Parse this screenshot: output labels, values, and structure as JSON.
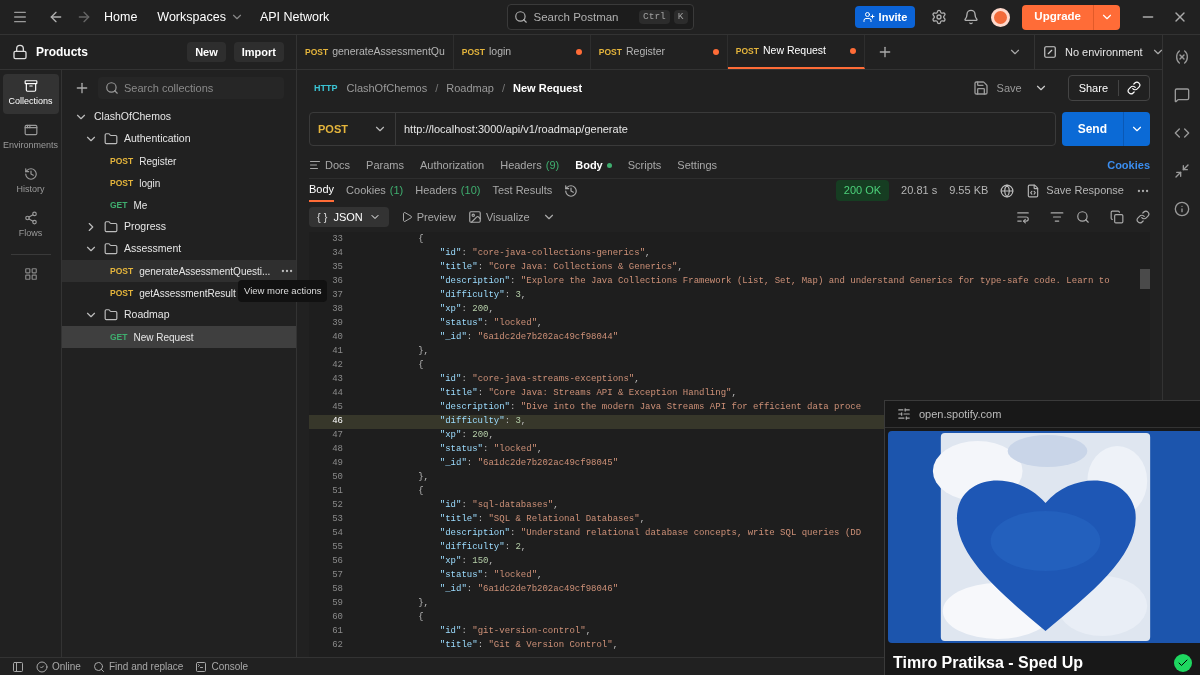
{
  "topbar": {
    "nav": [
      "Home",
      "Workspaces",
      "API Network"
    ],
    "search": {
      "placeholder": "Search Postman",
      "keys": [
        "Ctrl",
        "K"
      ]
    },
    "invite": "Invite",
    "upgrade": "Upgrade"
  },
  "sidebar": {
    "title": "Products",
    "buttons": [
      "New",
      "Import"
    ],
    "rail": [
      {
        "label": "Collections",
        "selected": true
      },
      {
        "label": "Environments",
        "selected": false
      },
      {
        "label": "History",
        "selected": false
      },
      {
        "label": "Flows",
        "selected": false
      }
    ],
    "search": {
      "placeholder": "Search collections"
    },
    "tree": [
      {
        "kind": "collection",
        "name": "ClashOfChemos",
        "expanded": true,
        "selected": false,
        "children": [
          {
            "kind": "folder",
            "name": "Authentication",
            "expanded": true,
            "selected": false,
            "children": [
              {
                "kind": "request",
                "method": {
                  "label": "POST",
                  "color": "#e5b53c"
                },
                "name": "Register",
                "selected": false,
                "hovered": false
              },
              {
                "kind": "request",
                "method": {
                  "label": "POST",
                  "color": "#e5b53c"
                },
                "name": "login",
                "selected": false,
                "hovered": false
              },
              {
                "kind": "request",
                "method": {
                  "label": "GET",
                  "color": "#3fae6f"
                },
                "name": "Me",
                "selected": false,
                "hovered": false
              }
            ]
          },
          {
            "kind": "folder",
            "name": "Progress",
            "expanded": false,
            "selected": false
          },
          {
            "kind": "folder",
            "name": "Assessment",
            "expanded": true,
            "selected": false,
            "children": [
              {
                "kind": "request",
                "method": {
                  "label": "POST",
                  "color": "#e5b53c"
                },
                "name": "generateAssessmentQuesti...",
                "selected": false,
                "hovered": true
              },
              {
                "kind": "request",
                "method": {
                  "label": "POST",
                  "color": "#e5b53c"
                },
                "name": "getAssessmentResult",
                "selected": false,
                "hovered": false
              }
            ]
          },
          {
            "kind": "folder",
            "name": "Roadmap",
            "expanded": true,
            "selected": false,
            "children": [
              {
                "kind": "request",
                "method": {
                  "label": "GET",
                  "color": "#3fae6f"
                },
                "name": "New Request",
                "selected": true,
                "hovered": false
              }
            ]
          }
        ]
      }
    ],
    "tooltip": "View more actions"
  },
  "tabs": [
    {
      "method": {
        "label": "POST",
        "color": "#e5b53c"
      },
      "name": "generateAssessmentQu",
      "unsaved": false,
      "selected": false
    },
    {
      "method": {
        "label": "POST",
        "color": "#e5b53c"
      },
      "name": "login",
      "unsaved": true,
      "selected": false
    },
    {
      "method": {
        "label": "POST",
        "color": "#e5b53c"
      },
      "name": "Register",
      "unsaved": true,
      "selected": false
    },
    {
      "method": {
        "label": "POST",
        "color": "#e5b53c"
      },
      "name": "New Request",
      "unsaved": true,
      "selected": true
    }
  ],
  "environment": "No environment",
  "breadcrumb": {
    "icon_label": "HTTP",
    "path": [
      {
        "label": "ClashOfChemos",
        "separator": "/"
      },
      {
        "label": "Roadmap",
        "separator": "/"
      }
    ],
    "current": "New Request"
  },
  "actions": {
    "save": "Save",
    "share": "Share"
  },
  "request": {
    "method": "POST",
    "url": "http://localhost:3000/api/v1/roadmap/generate",
    "send": "Send"
  },
  "request_tabs": [
    {
      "label": "Docs",
      "dot": false,
      "selected": false
    },
    {
      "label": "Params",
      "dot": false,
      "selected": false
    },
    {
      "label": "Authorization",
      "dot": false,
      "selected": false
    },
    {
      "label": "Headers",
      "count": "(9)",
      "dot": false,
      "selected": false
    },
    {
      "label": "Body",
      "dot": true,
      "selected": true
    },
    {
      "label": "Scripts",
      "dot": false,
      "selected": false
    },
    {
      "label": "Settings",
      "dot": false,
      "selected": false
    }
  ],
  "cookies_link": "Cookies",
  "response_tabs": [
    {
      "label": "Body",
      "selected": true
    },
    {
      "label": "Cookies",
      "count": "(1)",
      "selected": false
    },
    {
      "label": "Headers",
      "count": "(10)",
      "selected": false
    },
    {
      "label": "Test Results",
      "selected": false
    }
  ],
  "response_meta": {
    "status": "200 OK",
    "time": "20.81 s",
    "size": "9.55 KB",
    "save": "Save Response"
  },
  "viewer": {
    "format_icon": "{ }",
    "format": "JSON",
    "preview": "Preview",
    "visualize": "Visualize"
  },
  "code": [
    {
      "n": "33",
      "text": "        {",
      "current": false
    },
    {
      "n": "34",
      "text": "            \"id\": \"core-java-collections-generics\",",
      "current": false
    },
    {
      "n": "35",
      "text": "            \"title\": \"Core Java: Collections & Generics\",",
      "current": false
    },
    {
      "n": "36",
      "text": "            \"description\": \"Explore the Java Collections Framework (List, Set, Map) and understand Generics for type-safe code. Learn to",
      "current": false
    },
    {
      "n": "37",
      "text": "            \"difficulty\": 3,",
      "current": false
    },
    {
      "n": "38",
      "text": "            \"xp\": 200,",
      "current": false
    },
    {
      "n": "39",
      "text": "            \"status\": \"locked\",",
      "current": false
    },
    {
      "n": "40",
      "text": "            \"_id\": \"6a1dc2de7b202ac49cf98044\"",
      "current": false
    },
    {
      "n": "41",
      "text": "        },",
      "current": false
    },
    {
      "n": "42",
      "text": "        {",
      "current": false
    },
    {
      "n": "43",
      "text": "            \"id\": \"core-java-streams-exceptions\",",
      "current": false
    },
    {
      "n": "44",
      "text": "            \"title\": \"Core Java: Streams API & Exception Handling\",",
      "current": false
    },
    {
      "n": "45",
      "text": "            \"description\": \"Dive into the modern Java Streams API for efficient data proce",
      "current": false
    },
    {
      "n": "46",
      "text": "            \"difficulty\": 3,",
      "current": true
    },
    {
      "n": "47",
      "text": "            \"xp\": 200,",
      "current": false
    },
    {
      "n": "48",
      "text": "            \"status\": \"locked\",",
      "current": false
    },
    {
      "n": "49",
      "text": "            \"_id\": \"6a1dc2de7b202ac49cf98045\"",
      "current": false
    },
    {
      "n": "50",
      "text": "        },",
      "current": false
    },
    {
      "n": "51",
      "text": "        {",
      "current": false
    },
    {
      "n": "52",
      "text": "            \"id\": \"sql-databases\",",
      "current": false
    },
    {
      "n": "53",
      "text": "            \"title\": \"SQL & Relational Databases\",",
      "current": false
    },
    {
      "n": "54",
      "text": "            \"description\": \"Understand relational database concepts, write SQL queries (DD",
      "current": false
    },
    {
      "n": "55",
      "text": "            \"difficulty\": 2,",
      "current": false
    },
    {
      "n": "56",
      "text": "            \"xp\": 150,",
      "current": false
    },
    {
      "n": "57",
      "text": "            \"status\": \"locked\",",
      "current": false
    },
    {
      "n": "58",
      "text": "            \"_id\": \"6a1dc2de7b202ac49cf98046\"",
      "current": false
    },
    {
      "n": "59",
      "text": "        },",
      "current": false
    },
    {
      "n": "60",
      "text": "        {",
      "current": false
    },
    {
      "n": "61",
      "text": "            \"id\": \"git-version-control\",",
      "current": false
    },
    {
      "n": "62",
      "text": "            \"title\": \"Git & Version Control\",",
      "current": false
    }
  ],
  "status_bar": {
    "online": "Online",
    "find": "Find and replace",
    "console": "Console"
  },
  "media_popup": {
    "site": "open.spotify.com",
    "title": "Timro Pratiksa - Sped Up"
  }
}
